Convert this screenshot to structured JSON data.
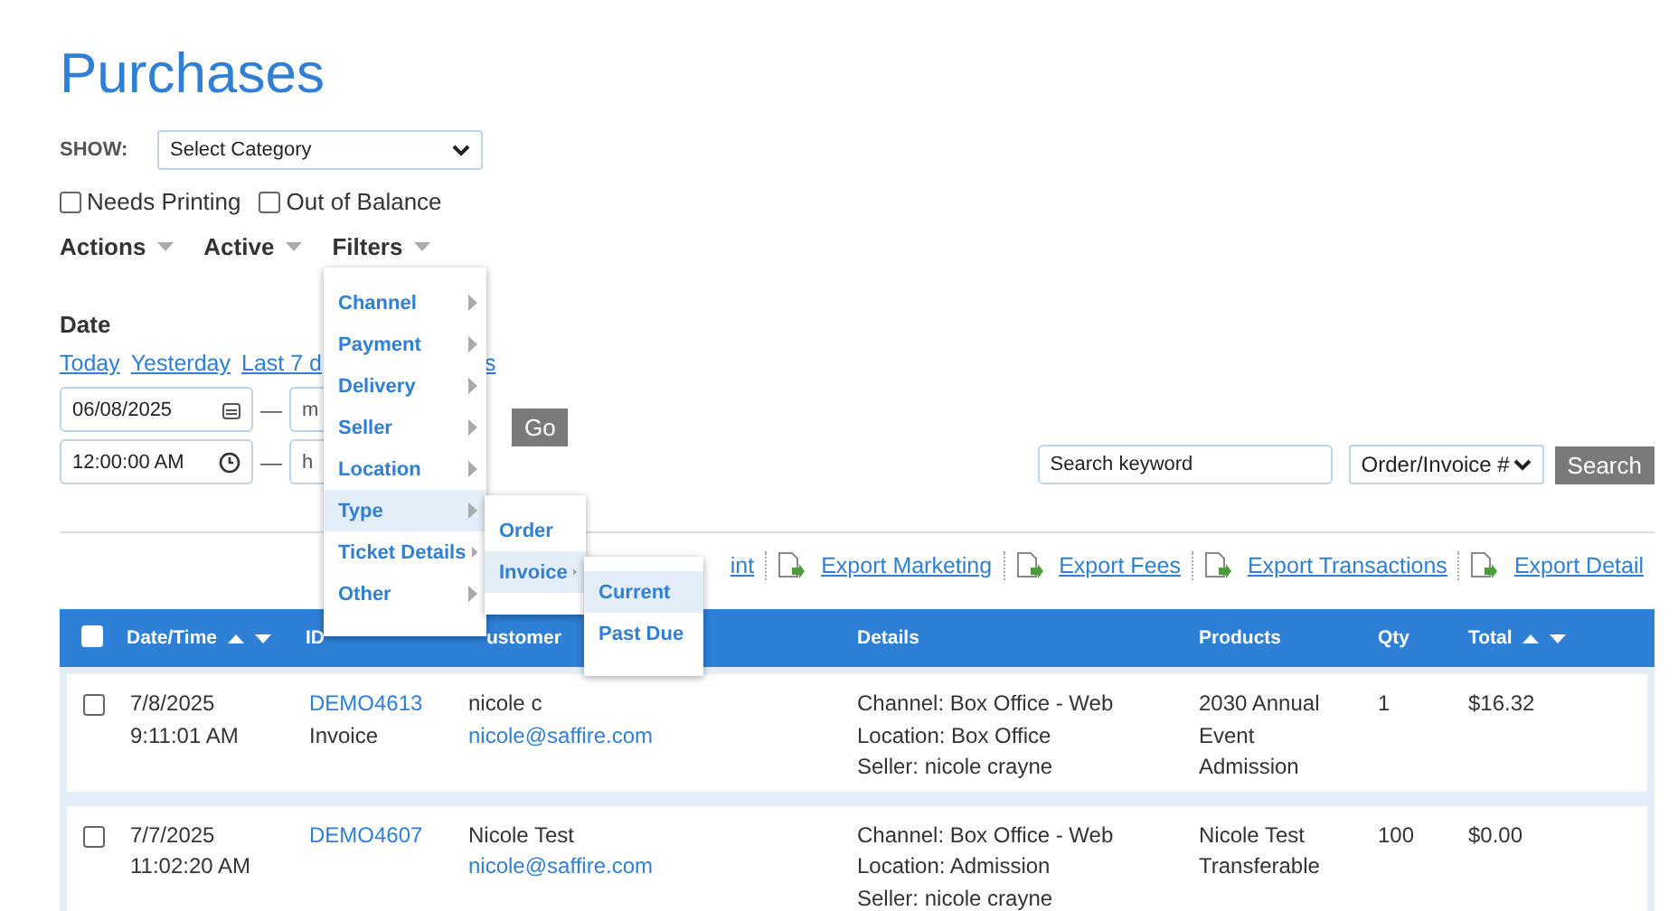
{
  "title": "Purchases",
  "show": {
    "label": "SHOW:",
    "value": "Select Category"
  },
  "checkboxes": [
    {
      "label": "Needs Printing",
      "checked": false
    },
    {
      "label": "Out of Balance",
      "checked": false
    }
  ],
  "menus": [
    "Actions",
    "Active",
    "Filters"
  ],
  "date": {
    "label": "Date",
    "links": [
      "Today",
      "Yesterday",
      "Last 7 d",
      "s"
    ],
    "start_date": "06/08/2025",
    "separator": "—",
    "end_date_placeholder": "m",
    "start_time": "12:00:00 AM",
    "end_time_placeholder": "h",
    "go": "Go"
  },
  "search": {
    "placeholder": "Search keyword",
    "field": "Order/Invoice #",
    "button": "Search"
  },
  "exports": [
    {
      "label": "int",
      "icon": false
    },
    {
      "label": "Export Marketing",
      "icon": true
    },
    {
      "label": "Export Fees",
      "icon": true
    },
    {
      "label": "Export Transactions",
      "icon": true
    },
    {
      "label": "Export Detail",
      "icon": true
    }
  ],
  "table": {
    "header_checked": false,
    "columns": [
      {
        "label": "Date/Time",
        "sortable": true
      },
      {
        "label": "ID",
        "sortable": false
      },
      {
        "label": "ustomer",
        "sortable": false
      },
      {
        "label": "Details",
        "sortable": false
      },
      {
        "label": "Products",
        "sortable": false
      },
      {
        "label": "Qty",
        "sortable": false
      },
      {
        "label": "Total",
        "sortable": true
      }
    ],
    "rows": [
      {
        "checked": false,
        "date": "7/8/2025",
        "time": "9:11:01 AM",
        "id": "DEMO4613",
        "type": "Invoice",
        "customer": "nicole c",
        "email": "nicole@saffire.com",
        "details": [
          "Channel: Box Office - Web",
          "Location: Box Office",
          "Seller: nicole crayne"
        ],
        "products": "2030 Annual Event Admission",
        "qty": "1",
        "total": "$16.32"
      },
      {
        "checked": false,
        "date": "7/7/2025",
        "time": "11:02:20 AM",
        "id": "DEMO4607",
        "customer": "Nicole Test",
        "email": "nicole@saffire.com",
        "details": [
          "Channel: Box Office - Web",
          "Location: Admission",
          "Seller: nicole crayne"
        ],
        "products": "Nicole Test Transferable",
        "qty": "100",
        "total": "$0.00"
      }
    ]
  },
  "filter_menu": [
    {
      "label": "Channel",
      "selected": false
    },
    {
      "label": "Payment",
      "selected": false
    },
    {
      "label": "Delivery",
      "selected": false
    },
    {
      "label": "Seller",
      "selected": false
    },
    {
      "label": "Location",
      "selected": false
    },
    {
      "label": "Type",
      "selected": true,
      "children": [
        {
          "label": "Order",
          "selected": false
        },
        {
          "label": "Invoice",
          "selected": true,
          "children": [
            {
              "label": "Current",
              "selected": true
            },
            {
              "label": "Past Due",
              "selected": false
            }
          ]
        }
      ]
    },
    {
      "label": "Ticket Details",
      "selected": false
    },
    {
      "label": "Other",
      "selected": false
    }
  ]
}
